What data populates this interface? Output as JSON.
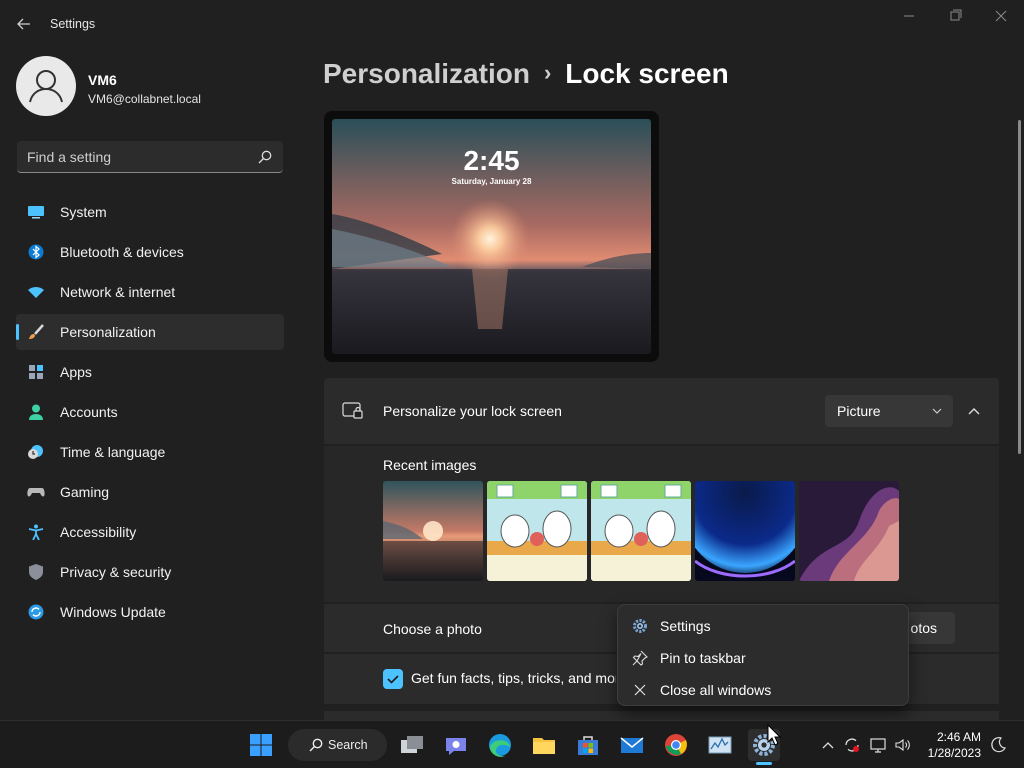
{
  "window": {
    "title": "Settings",
    "controls": {
      "minimize": "minimize-icon",
      "maximize": "maximize-icon",
      "close": "close-icon"
    }
  },
  "profile": {
    "name": "VM6",
    "email": "VM6@collabnet.local"
  },
  "search": {
    "placeholder": "Find a setting"
  },
  "sidebar": {
    "items": [
      {
        "label": "System",
        "icon": "monitor-icon"
      },
      {
        "label": "Bluetooth & devices",
        "icon": "bluetooth-icon"
      },
      {
        "label": "Network & internet",
        "icon": "wifi-icon"
      },
      {
        "label": "Personalization",
        "icon": "brush-icon",
        "active": true
      },
      {
        "label": "Apps",
        "icon": "apps-icon"
      },
      {
        "label": "Accounts",
        "icon": "person-icon"
      },
      {
        "label": "Time & language",
        "icon": "clock-globe-icon"
      },
      {
        "label": "Gaming",
        "icon": "gamepad-icon"
      },
      {
        "label": "Accessibility",
        "icon": "accessibility-icon"
      },
      {
        "label": "Privacy & security",
        "icon": "shield-icon"
      },
      {
        "label": "Windows Update",
        "icon": "update-icon"
      }
    ]
  },
  "breadcrumb": {
    "parent": "Personalization",
    "separator": "›",
    "current": "Lock screen"
  },
  "preview": {
    "time": "2:45",
    "date": "Saturday, January 28"
  },
  "lockscreen": {
    "personalize_label": "Personalize your lock screen",
    "dropdown_value": "Picture",
    "recent_images_label": "Recent images",
    "recent_images": [
      "sunset-lake",
      "cartoon-kitchen",
      "cartoon-kitchen",
      "blue-bloom",
      "purple-swirl"
    ],
    "choose_photo_label": "Choose a photo",
    "browse_label": "otos",
    "fun_facts_label": "Get fun facts, tips, tricks, and more",
    "fun_facts_checked": true
  },
  "context_menu": {
    "items": [
      {
        "label": "Settings",
        "icon": "gear-icon"
      },
      {
        "label": "Pin to taskbar",
        "icon": "pin-icon"
      },
      {
        "label": "Close all windows",
        "icon": "close-icon"
      }
    ]
  },
  "taskbar": {
    "search_label": "Search",
    "apps": [
      "start-icon",
      "task-view-icon",
      "teams-chat-icon",
      "edge-icon",
      "file-explorer-icon",
      "store-icon",
      "mail-icon",
      "chrome-icon",
      "resource-monitor-icon",
      "settings-icon"
    ],
    "clock_time": "2:46 AM",
    "clock_date": "1/28/2023"
  },
  "colors": {
    "accent": "#4cc2ff",
    "background": "#202020",
    "card": "#2b2b2b"
  }
}
